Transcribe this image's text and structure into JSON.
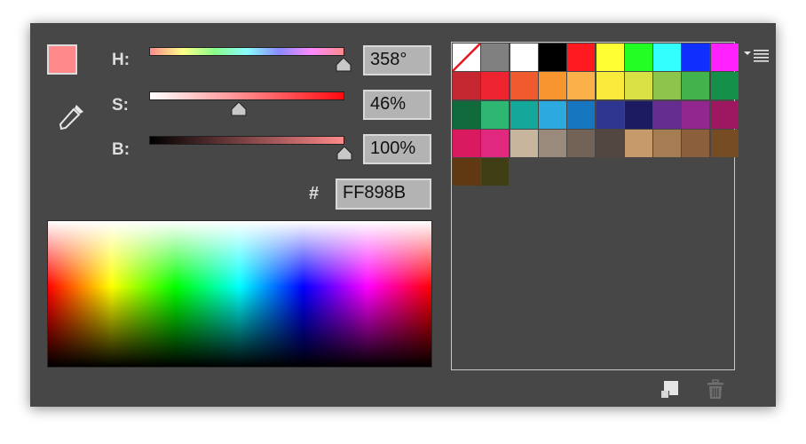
{
  "color": {
    "current_hex_color": "#FF898B",
    "labels": {
      "h": "H:",
      "s": "S:",
      "b": "B:",
      "hash": "#"
    },
    "values": {
      "h": "358°",
      "s": "46%",
      "b": "100%",
      "hex": "FF898B"
    },
    "sliders": {
      "h_level": 0.994,
      "s_level": 0.46,
      "b_level": 1.0
    }
  },
  "swatches": [
    [
      "none",
      "#808080",
      "#ffffff",
      "#000000",
      "#ff1a22",
      "#ffff33",
      "#22ff22",
      "#33ffff",
      "#0f2fff",
      "#ff22ff"
    ],
    [
      "#c4272f",
      "#ee2430",
      "#f15a2f",
      "#f7952f",
      "#fbb04a",
      "#faea3b",
      "#d8e043",
      "#8dc44c",
      "#42b24c",
      "#15904a"
    ],
    [
      "#106a3b",
      "#2db773",
      "#14a89a",
      "#2caae0",
      "#1676bf",
      "#2e368f",
      "#1c1a60",
      "#662d91",
      "#92278f",
      "#9d1860"
    ],
    [
      "#d91a5e",
      "#e0287f",
      "#c8b59e",
      "#9a8a7c",
      "#736357",
      "#524741",
      "#c79a6b",
      "#a67c52",
      "#8b5e3c",
      "#754c24"
    ],
    [
      "#603913",
      "#3f3e15"
    ]
  ]
}
